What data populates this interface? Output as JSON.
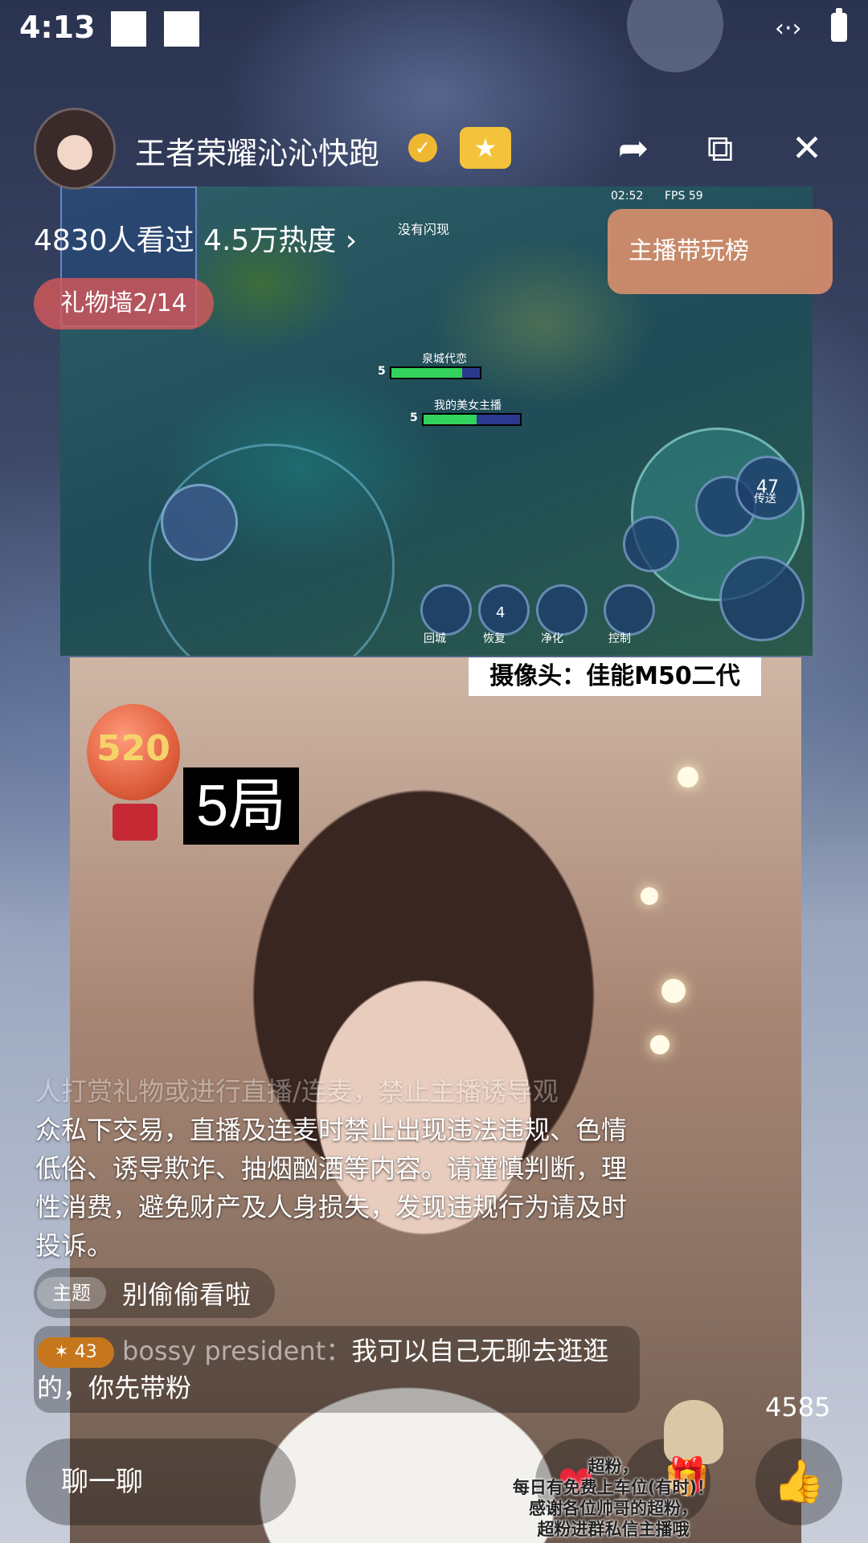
{
  "status_bar": {
    "time": "4:13"
  },
  "header": {
    "streamer_name": "王者荣耀沁沁快跑",
    "verified_glyph": "✓",
    "follow_glyph": "★",
    "share_glyph": "➦",
    "screen_glyph": "⧉",
    "close_glyph": "✕",
    "viewers": "4830人看过",
    "heat": "4.5万热度",
    "heat_chevron": "›",
    "gift_wall": "礼物墙2/14",
    "ranking": "主播带玩榜"
  },
  "game": {
    "time": "02:52",
    "fps": "FPS 59",
    "enemy_tag": "没有闪现",
    "ally_tag": "泉城代恋",
    "player_tag": "我的美女主播",
    "level_a": "5",
    "level_b": "5",
    "counter": "47",
    "counter_label": "传送",
    "skill_labels": [
      "回城",
      "恢复",
      "净化",
      "控制"
    ],
    "heal_count": "4"
  },
  "camera_label": "摄像头：佳能M50二代",
  "balloon_text": "520",
  "round_label": "5局",
  "chat": {
    "notice_faded": "人打赏礼物或进行直播/连麦，禁止主播诱导观",
    "notice": "众私下交易，直播及连麦时禁止出现违法违规、色情低俗、诱导欺诈、抽烟酗酒等内容。请谨慎判断，理性消费，避免财产及人身损失，发现违规行为请及时投诉。",
    "topic_badge": "主题",
    "topic_text": "别偷偷看啦",
    "message": {
      "level": "43",
      "user": "bossy president：",
      "text": "我可以自己无聊去逛逛的，你先带粉"
    }
  },
  "bottom": {
    "like_count": "4585",
    "chat_placeholder": "聊一聊",
    "heart_glyph": "❤",
    "gift_glyph": "🎁",
    "like_glyph": "👍",
    "promo_line1": "超粉，",
    "promo_line2": "每日有免费上车位(有时)！",
    "promo_line3": "感谢各位帅哥的超粉，",
    "promo_line4": "超粉进群私信主播哦"
  },
  "colors": {
    "gift_wall_bg": "#dc5a5a",
    "ranking_bg": "#eb966e",
    "follow_bg": "#f5c33b",
    "level_badge": "#c6761c"
  }
}
